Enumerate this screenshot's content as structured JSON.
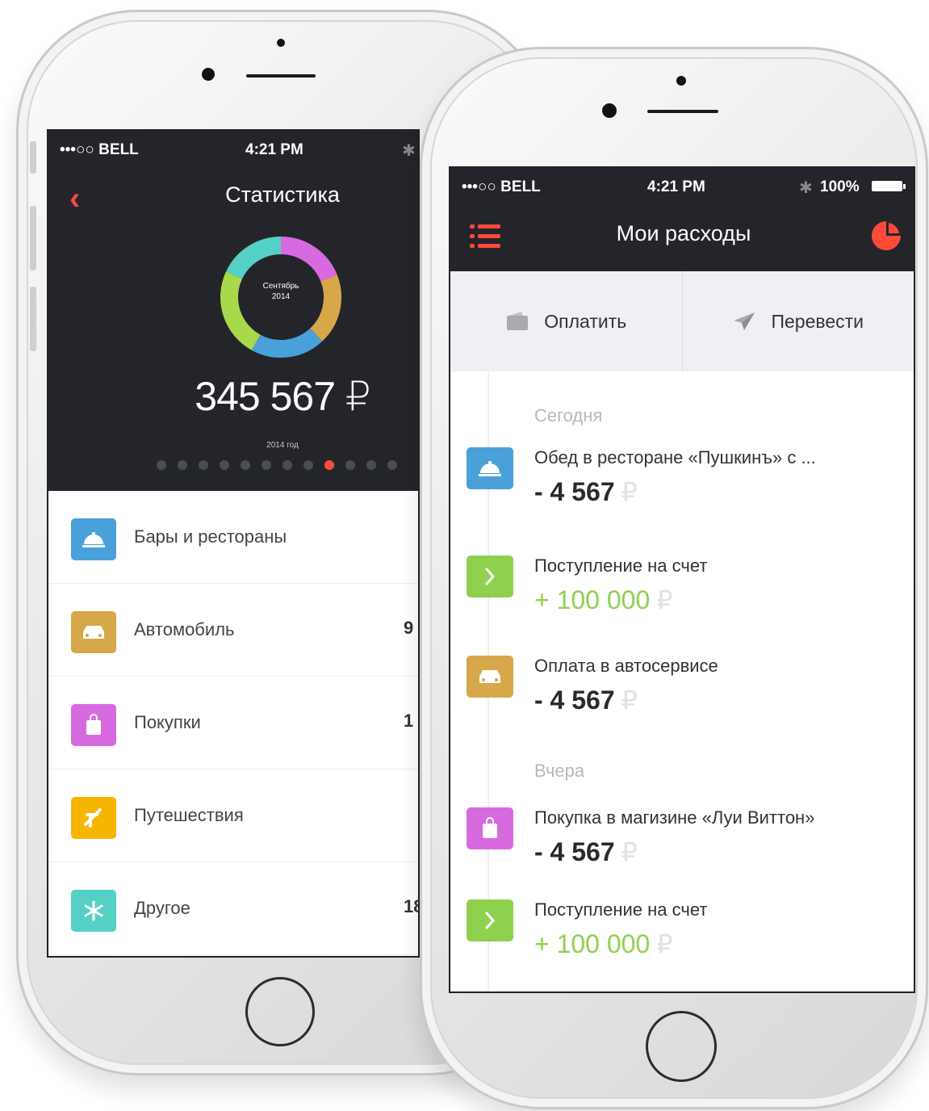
{
  "colors": {
    "dark_bg": "#24252a",
    "accent_red": "#ff4a3a",
    "green": "#8fd14f",
    "blue": "#4aa0d9",
    "gold": "#d6a84a",
    "purple": "#d86ae0",
    "yellow": "#f6b500",
    "teal": "#55d0c4",
    "action_bar_bg": "#eff0f5"
  },
  "back_phone": {
    "status_bar": {
      "carrier": "•••○○ BELL",
      "time": "4:21 PM"
    },
    "header": {
      "back_icon": "chevron-left-icon",
      "title": "Статистика"
    },
    "donut": {
      "label_line1": "Сентябрь",
      "label_line2": "2014",
      "segments": [
        {
          "name": "purple",
          "color": "#d86ae0",
          "fraction": 0.19
        },
        {
          "name": "gold",
          "color": "#d6a84a",
          "fraction": 0.19
        },
        {
          "name": "blue",
          "color": "#4aa0d9",
          "fraction": 0.2
        },
        {
          "name": "green",
          "color": "#a8d94a",
          "fraction": 0.24
        },
        {
          "name": "teal",
          "color": "#55d0c4",
          "fraction": 0.18
        }
      ]
    },
    "total_amount": "345 567 ₽",
    "year_label": "2014 год",
    "pager": {
      "count": 12,
      "active_index": 8
    },
    "categories": [
      {
        "label": "Бары и рестораны",
        "value": "",
        "icon": "cloche-icon",
        "color": "#4aa0d9"
      },
      {
        "label": "Автомобиль",
        "value": "9",
        "icon": "car-icon",
        "color": "#d6a84a"
      },
      {
        "label": "Покупки",
        "value": "1",
        "icon": "shopping-bag-icon",
        "color": "#d86ae0"
      },
      {
        "label": "Путешествия",
        "value": "",
        "icon": "airplane-icon",
        "color": "#f6b500"
      },
      {
        "label": "Другое",
        "value": "18",
        "icon": "asterisk-icon",
        "color": "#55d0c4"
      }
    ]
  },
  "front_phone": {
    "status_bar": {
      "carrier": "•••○○ BELL",
      "time": "4:21 PM",
      "bluetooth_icon": "bluetooth-icon",
      "battery": "100%",
      "battery_level": 1.0
    },
    "header": {
      "menu_icon": "list-menu-icon",
      "title": "Мои расходы",
      "stats_icon": "pie-chart-icon"
    },
    "actions": [
      {
        "label": "Оплатить",
        "icon": "wallet-icon"
      },
      {
        "label": "Перевести",
        "icon": "send-icon"
      }
    ],
    "sections": [
      {
        "label": "Сегодня"
      },
      {
        "label": "Вчера"
      }
    ],
    "transactions": [
      {
        "title": "Обед в ресторане «Пушкинъ» с ...",
        "amount": "- 4 567",
        "currency": "₽",
        "type": "expense",
        "icon": "cloche-icon",
        "color": "#4aa0d9"
      },
      {
        "title": "Поступление на счет",
        "amount": "+ 100 000",
        "currency": "₽",
        "type": "income",
        "icon": "chevron-right-icon",
        "color": "#8fd14f"
      },
      {
        "title": "Оплата в автосервисе",
        "amount": "- 4 567",
        "currency": "₽",
        "type": "expense",
        "icon": "car-icon",
        "color": "#d6a84a"
      },
      {
        "title": "Покупка в магизине «Луи Виттон»",
        "amount": "- 4 567",
        "currency": "₽",
        "type": "expense",
        "icon": "shopping-bag-icon",
        "color": "#d86ae0"
      },
      {
        "title": "Поступление на счет",
        "amount": "+ 100 000",
        "currency": "₽",
        "type": "income",
        "icon": "chevron-right-icon",
        "color": "#8fd14f"
      }
    ]
  }
}
